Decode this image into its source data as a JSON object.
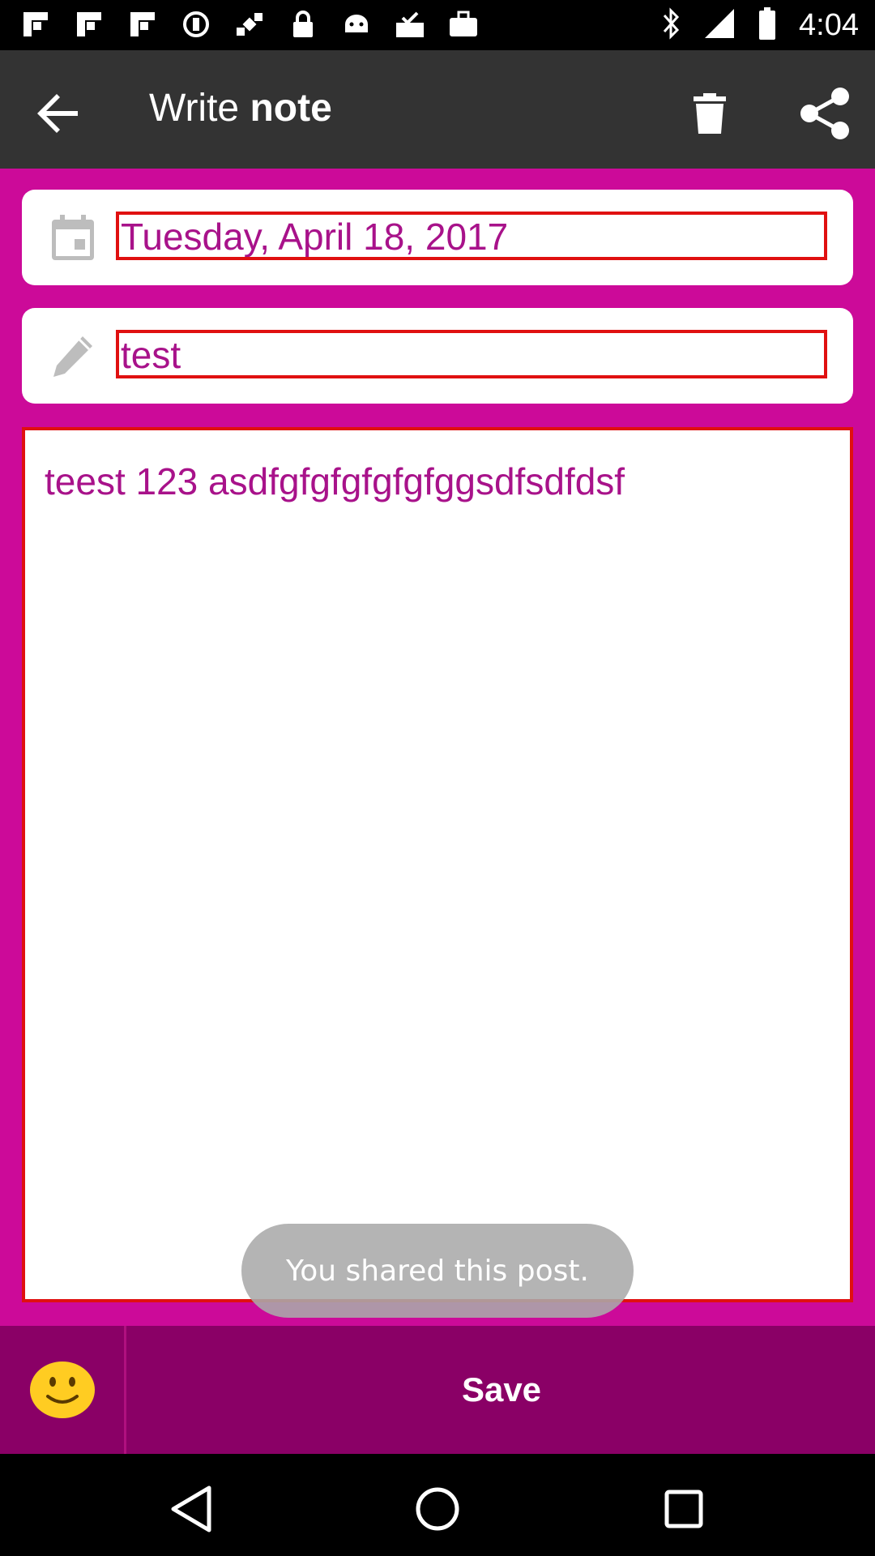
{
  "status_bar": {
    "time": "4:04",
    "icons": [
      "flipboard-icon",
      "flipboard-icon",
      "flipboard-icon",
      "sync-icon",
      "satellite-icon",
      "lock-icon",
      "android-icon",
      "inbox-check-icon",
      "briefcase-icon",
      "bluetooth-icon",
      "signal-icon",
      "battery-icon"
    ]
  },
  "app_bar": {
    "title_light": "Write",
    "title_bold": "note",
    "back_icon": "arrow-back-icon",
    "delete_icon": "trash-icon",
    "share_icon": "share-icon"
  },
  "date_field": {
    "icon": "calendar-icon",
    "value": "Tuesday, April 18, 2017"
  },
  "title_field": {
    "icon": "pencil-icon",
    "value": "test"
  },
  "note": {
    "value": "teest 123 asdfgfgfgfgfgfggsdfsdfdsf"
  },
  "toast": {
    "text": "You shared this post."
  },
  "bottom": {
    "emoji_icon": "smiley-icon",
    "save_label": "Save"
  },
  "nav": {
    "back_icon": "nav-back-icon",
    "home_icon": "nav-home-icon",
    "recents_icon": "nav-recents-icon"
  },
  "colors": {
    "background": "#cc0a99",
    "toolbar": "#333333",
    "bottom_bar": "#8a0066",
    "text_accent": "#a8128a",
    "field_border": "#e01010"
  }
}
